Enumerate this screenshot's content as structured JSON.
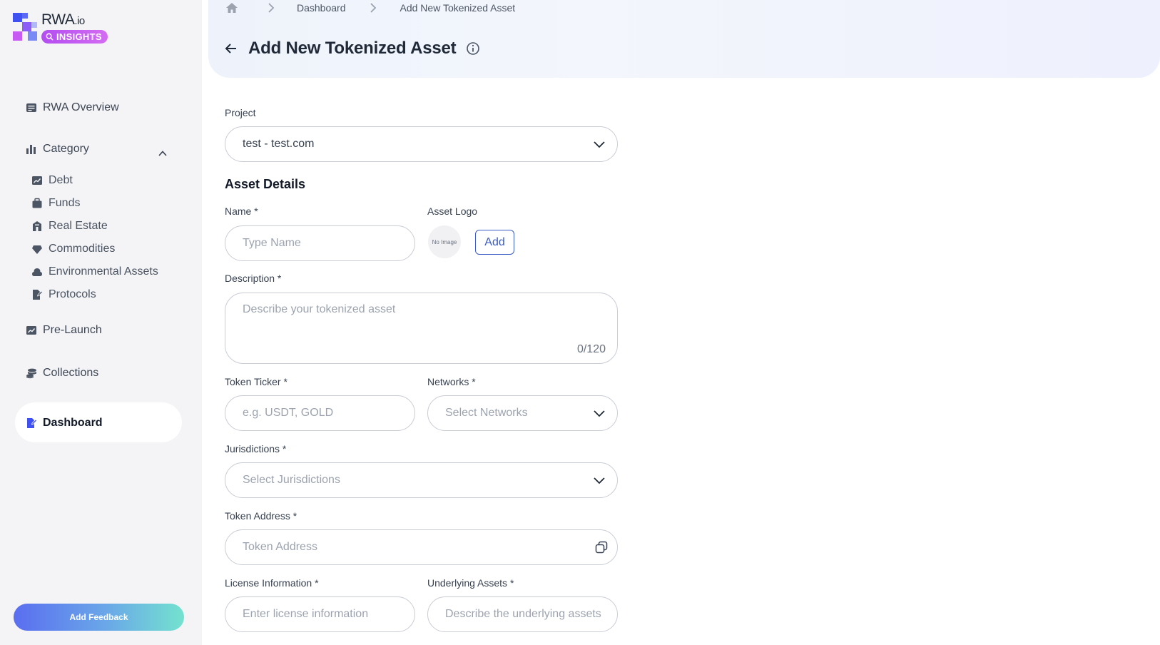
{
  "brand": {
    "name": "RWA",
    "suffix": ".io",
    "badge": "INSIGHTS"
  },
  "sidebar": {
    "overview": "RWA Overview",
    "category": "Category",
    "sub_items": [
      "Debt",
      "Funds",
      "Real Estate",
      "Commodities",
      "Environmental Assets",
      "Protocols"
    ],
    "prelaunch": "Pre-Launch",
    "collections": "Collections",
    "dashboard": "Dashboard",
    "feedback": "Add Feedback"
  },
  "breadcrumb": {
    "items": [
      "Dashboard",
      "Add New Tokenized Asset"
    ]
  },
  "page": {
    "title": "Add New Tokenized Asset"
  },
  "form": {
    "project": {
      "label": "Project",
      "value": "test - test.com"
    },
    "section_title": "Asset Details",
    "name": {
      "label": "Name *",
      "placeholder": "Type Name"
    },
    "logo": {
      "label": "Asset Logo",
      "no_image": "No Image",
      "add": "Add"
    },
    "description": {
      "label": "Description *",
      "placeholder": "Describe your tokenized asset",
      "counter": "0/120"
    },
    "ticker": {
      "label": "Token Ticker *",
      "placeholder": "e.g. USDT, GOLD"
    },
    "networks": {
      "label": "Networks *",
      "placeholder": "Select Networks"
    },
    "jurisdictions": {
      "label": "Jurisdictions *",
      "placeholder": "Select Jurisdictions"
    },
    "token_address": {
      "label": "Token Address *",
      "placeholder": "Token Address"
    },
    "license": {
      "label": "License Information *",
      "placeholder": "Enter license information"
    },
    "underlying": {
      "label": "Underlying Assets *",
      "placeholder": "Describe the underlying assets"
    }
  },
  "colors": {
    "accent": "#3b5bc7",
    "badge": "#c05cf1",
    "sidebar_bg": "#f4f4f6"
  }
}
